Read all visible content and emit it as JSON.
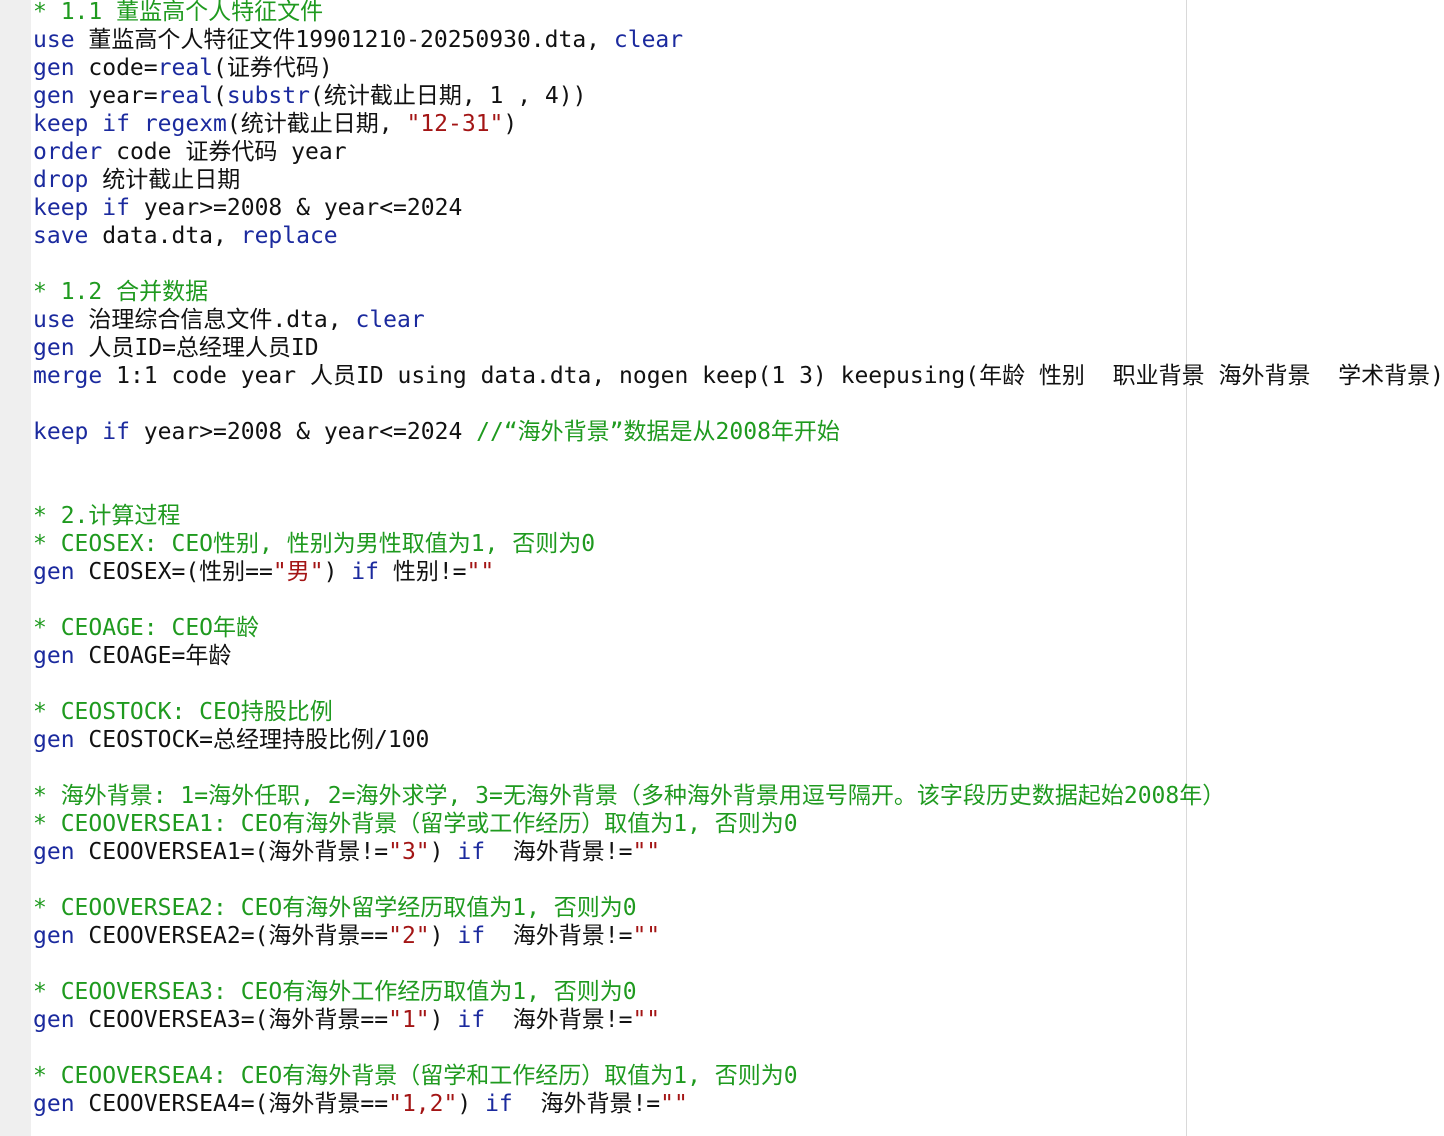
{
  "theme": {
    "plain": "#111111",
    "keyword": "#1b2a9e",
    "string": "#a31515",
    "comment": "#1f9a1f",
    "gutter": "#efefef"
  },
  "lines": [
    [
      {
        "t": "c",
        "s": "* 1.1 董监高个人特征文件"
      }
    ],
    [
      {
        "t": "k",
        "s": "use"
      },
      {
        "t": "p",
        "s": " 董监高个人特征文件19901210-20250930.dta, "
      },
      {
        "t": "k",
        "s": "clear"
      }
    ],
    [
      {
        "t": "k",
        "s": "gen"
      },
      {
        "t": "p",
        "s": " code="
      },
      {
        "t": "k",
        "s": "real"
      },
      {
        "t": "p",
        "s": "(证券代码)"
      }
    ],
    [
      {
        "t": "k",
        "s": "gen"
      },
      {
        "t": "p",
        "s": " year="
      },
      {
        "t": "k",
        "s": "real"
      },
      {
        "t": "p",
        "s": "("
      },
      {
        "t": "k",
        "s": "substr"
      },
      {
        "t": "p",
        "s": "(统计截止日期, 1 , 4))"
      }
    ],
    [
      {
        "t": "k",
        "s": "keep"
      },
      {
        "t": "p",
        "s": " "
      },
      {
        "t": "k",
        "s": "if"
      },
      {
        "t": "p",
        "s": " "
      },
      {
        "t": "k",
        "s": "regexm"
      },
      {
        "t": "p",
        "s": "(统计截止日期, "
      },
      {
        "t": "s",
        "s": "\"12-31\""
      },
      {
        "t": "p",
        "s": ")"
      }
    ],
    [
      {
        "t": "k",
        "s": "order"
      },
      {
        "t": "p",
        "s": " code 证券代码 year"
      }
    ],
    [
      {
        "t": "k",
        "s": "drop"
      },
      {
        "t": "p",
        "s": " 统计截止日期"
      }
    ],
    [
      {
        "t": "k",
        "s": "keep"
      },
      {
        "t": "p",
        "s": " "
      },
      {
        "t": "k",
        "s": "if"
      },
      {
        "t": "p",
        "s": " year>=2008 & year<=2024"
      }
    ],
    [
      {
        "t": "k",
        "s": "save"
      },
      {
        "t": "p",
        "s": " data.dta, "
      },
      {
        "t": "k",
        "s": "replace"
      }
    ],
    [],
    [
      {
        "t": "c",
        "s": "* 1.2 合并数据"
      }
    ],
    [
      {
        "t": "k",
        "s": "use"
      },
      {
        "t": "p",
        "s": " 治理综合信息文件.dta, "
      },
      {
        "t": "k",
        "s": "clear"
      }
    ],
    [
      {
        "t": "k",
        "s": "gen"
      },
      {
        "t": "p",
        "s": " 人员ID=总经理人员ID"
      }
    ],
    [
      {
        "t": "k",
        "s": "merge"
      },
      {
        "t": "p",
        "s": " 1:1 code year 人员ID using data.dta, nogen keep(1 3) keepusing(年龄 性别  职业背景 海外背景  学术背景)"
      }
    ],
    [],
    [
      {
        "t": "k",
        "s": "keep"
      },
      {
        "t": "p",
        "s": " "
      },
      {
        "t": "k",
        "s": "if"
      },
      {
        "t": "p",
        "s": " year>=2008 & year<=2024 "
      },
      {
        "t": "c",
        "s": "//“海外背景”数据是从2008年开始"
      }
    ],
    [],
    [],
    [
      {
        "t": "c",
        "s": "* 2.计算过程"
      }
    ],
    [
      {
        "t": "c",
        "s": "* CEOSEX: CEO性别, 性别为男性取值为1, 否则为0"
      }
    ],
    [
      {
        "t": "k",
        "s": "gen"
      },
      {
        "t": "p",
        "s": " CEOSEX=(性别=="
      },
      {
        "t": "s",
        "s": "\"男\""
      },
      {
        "t": "p",
        "s": ") "
      },
      {
        "t": "k",
        "s": "if"
      },
      {
        "t": "p",
        "s": " 性别!="
      },
      {
        "t": "s",
        "s": "\"\""
      }
    ],
    [],
    [
      {
        "t": "c",
        "s": "* CEOAGE: CEO年龄"
      }
    ],
    [
      {
        "t": "k",
        "s": "gen"
      },
      {
        "t": "p",
        "s": " CEOAGE=年龄"
      }
    ],
    [],
    [
      {
        "t": "c",
        "s": "* CEOSTOCK: CEO持股比例"
      }
    ],
    [
      {
        "t": "k",
        "s": "gen"
      },
      {
        "t": "p",
        "s": " CEOSTOCK=总经理持股比例/100"
      }
    ],
    [],
    [
      {
        "t": "c",
        "s": "* 海外背景: 1=海外任职, 2=海外求学, 3=无海外背景（多种海外背景用逗号隔开。该字段历史数据起始2008年）"
      }
    ],
    [
      {
        "t": "c",
        "s": "* CEOOVERSEA1: CEO有海外背景（留学或工作经历）取值为1, 否则为0"
      }
    ],
    [
      {
        "t": "k",
        "s": "gen"
      },
      {
        "t": "p",
        "s": " CEOOVERSEA1=(海外背景!="
      },
      {
        "t": "s",
        "s": "\"3\""
      },
      {
        "t": "p",
        "s": ") "
      },
      {
        "t": "k",
        "s": "if"
      },
      {
        "t": "p",
        "s": "  海外背景!="
      },
      {
        "t": "s",
        "s": "\"\""
      }
    ],
    [],
    [
      {
        "t": "c",
        "s": "* CEOOVERSEA2: CEO有海外留学经历取值为1, 否则为0"
      }
    ],
    [
      {
        "t": "k",
        "s": "gen"
      },
      {
        "t": "p",
        "s": " CEOOVERSEA2=(海外背景=="
      },
      {
        "t": "s",
        "s": "\"2\""
      },
      {
        "t": "p",
        "s": ") "
      },
      {
        "t": "k",
        "s": "if"
      },
      {
        "t": "p",
        "s": "  海外背景!="
      },
      {
        "t": "s",
        "s": "\"\""
      }
    ],
    [],
    [
      {
        "t": "c",
        "s": "* CEOOVERSEA3: CEO有海外工作经历取值为1, 否则为0"
      }
    ],
    [
      {
        "t": "k",
        "s": "gen"
      },
      {
        "t": "p",
        "s": " CEOOVERSEA3=(海外背景=="
      },
      {
        "t": "s",
        "s": "\"1\""
      },
      {
        "t": "p",
        "s": ") "
      },
      {
        "t": "k",
        "s": "if"
      },
      {
        "t": "p",
        "s": "  海外背景!="
      },
      {
        "t": "s",
        "s": "\"\""
      }
    ],
    [],
    [
      {
        "t": "c",
        "s": "* CEOOVERSEA4: CEO有海外背景（留学和工作经历）取值为1, 否则为0"
      }
    ],
    [
      {
        "t": "k",
        "s": "gen"
      },
      {
        "t": "p",
        "s": " CEOOVERSEA4=(海外背景=="
      },
      {
        "t": "s",
        "s": "\"1,2\""
      },
      {
        "t": "p",
        "s": ") "
      },
      {
        "t": "k",
        "s": "if"
      },
      {
        "t": "p",
        "s": "  海外背景!="
      },
      {
        "t": "s",
        "s": "\"\""
      }
    ]
  ]
}
